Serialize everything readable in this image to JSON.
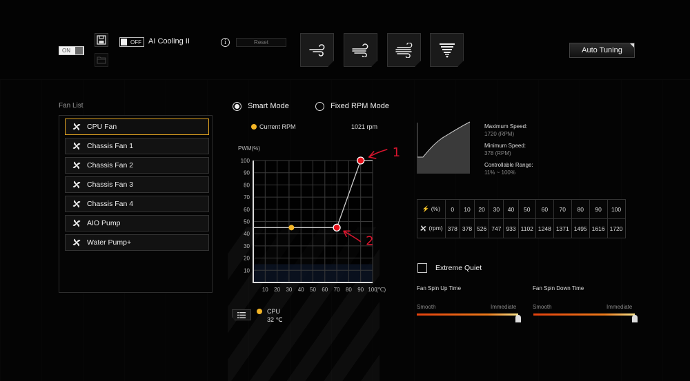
{
  "topbar": {
    "power_toggle": {
      "label": "ON",
      "state": "on"
    },
    "save_icon": "save-icon",
    "open_icon": "folder-icon",
    "ai_cooling": {
      "toggle_label": "OFF",
      "state": "off",
      "title": "AI Cooling II"
    },
    "info_icon": "info-icon",
    "reset_label": "Reset",
    "preset_modes": [
      {
        "name": "silent",
        "icon": "wind-1-icon"
      },
      {
        "name": "standard",
        "icon": "wind-2-icon"
      },
      {
        "name": "turbo",
        "icon": "wind-3-icon"
      },
      {
        "name": "full-speed",
        "icon": "tornado-icon"
      }
    ],
    "auto_tuning_label": "Auto Tuning"
  },
  "fan_list": {
    "title": "Fan List",
    "selected": "CPU Fan",
    "items": [
      {
        "label": "CPU Fan"
      },
      {
        "label": "Chassis Fan 1"
      },
      {
        "label": "Chassis Fan 2"
      },
      {
        "label": "Chassis Fan 3"
      },
      {
        "label": "Chassis Fan 4"
      },
      {
        "label": "AIO Pump"
      },
      {
        "label": "Water Pump+"
      }
    ]
  },
  "modes": {
    "smart": {
      "label": "Smart Mode",
      "checked": true
    },
    "fixed": {
      "label": "Fixed RPM Mode",
      "checked": false
    }
  },
  "current": {
    "label": "Current RPM",
    "value": "1021 rpm"
  },
  "sensor": {
    "name": "CPU",
    "temp": "32 ℃"
  },
  "colors": {
    "accent": "#e0a321",
    "point": "#e8101a",
    "current_dot": "#f3b526",
    "annotation": "#d8152e",
    "quiet_zone": "#1a2c4e"
  },
  "chart_data": {
    "type": "line",
    "title": "",
    "ylabel": "PWM(%)",
    "xlabel": "(℃)",
    "xlim": [
      0,
      100
    ],
    "ylim": [
      0,
      100
    ],
    "x_ticks": [
      "10",
      "20",
      "30",
      "40",
      "50",
      "60",
      "70",
      "80",
      "90",
      "100"
    ],
    "y_ticks": [
      "10",
      "20",
      "30",
      "40",
      "50",
      "60",
      "70",
      "80",
      "90",
      "100"
    ],
    "grid": true,
    "series": [
      {
        "name": "fan-curve",
        "points": [
          [
            0,
            45
          ],
          [
            70,
            45
          ],
          [
            90,
            100
          ],
          [
            100,
            100
          ]
        ]
      }
    ],
    "control_points": [
      {
        "x": 70,
        "y": 45,
        "annotation": "2"
      },
      {
        "x": 90,
        "y": 100,
        "annotation": "1"
      }
    ],
    "current_point": {
      "x": 32,
      "y": 45
    },
    "quiet_zone_max": 15
  },
  "speed_info": {
    "max_label": "Maximum Speed:",
    "max_value": "1720 (RPM)",
    "min_label": "Minimum Speed:",
    "min_value": "378 (RPM)",
    "range_label": "Controllable Range:",
    "range_value": "11% ~ 100%"
  },
  "rpm_table": {
    "pwm_header": "(%)",
    "rpm_header": "(rpm)",
    "pwm": [
      "0",
      "10",
      "20",
      "30",
      "40",
      "50",
      "60",
      "70",
      "80",
      "90",
      "100"
    ],
    "rpm": [
      "378",
      "378",
      "526",
      "747",
      "933",
      "1102",
      "1248",
      "1371",
      "1495",
      "1616",
      "1720"
    ]
  },
  "extreme_quiet": {
    "label": "Extreme Quiet",
    "checked": false
  },
  "spin_up": {
    "title": "Fan Spin Up Time",
    "left": "Smooth",
    "right": "Immediate",
    "value_fraction": 1.0
  },
  "spin_down": {
    "title": "Fan Spin Down Time",
    "left": "Smooth",
    "right": "Immediate",
    "value_fraction": 1.0
  }
}
